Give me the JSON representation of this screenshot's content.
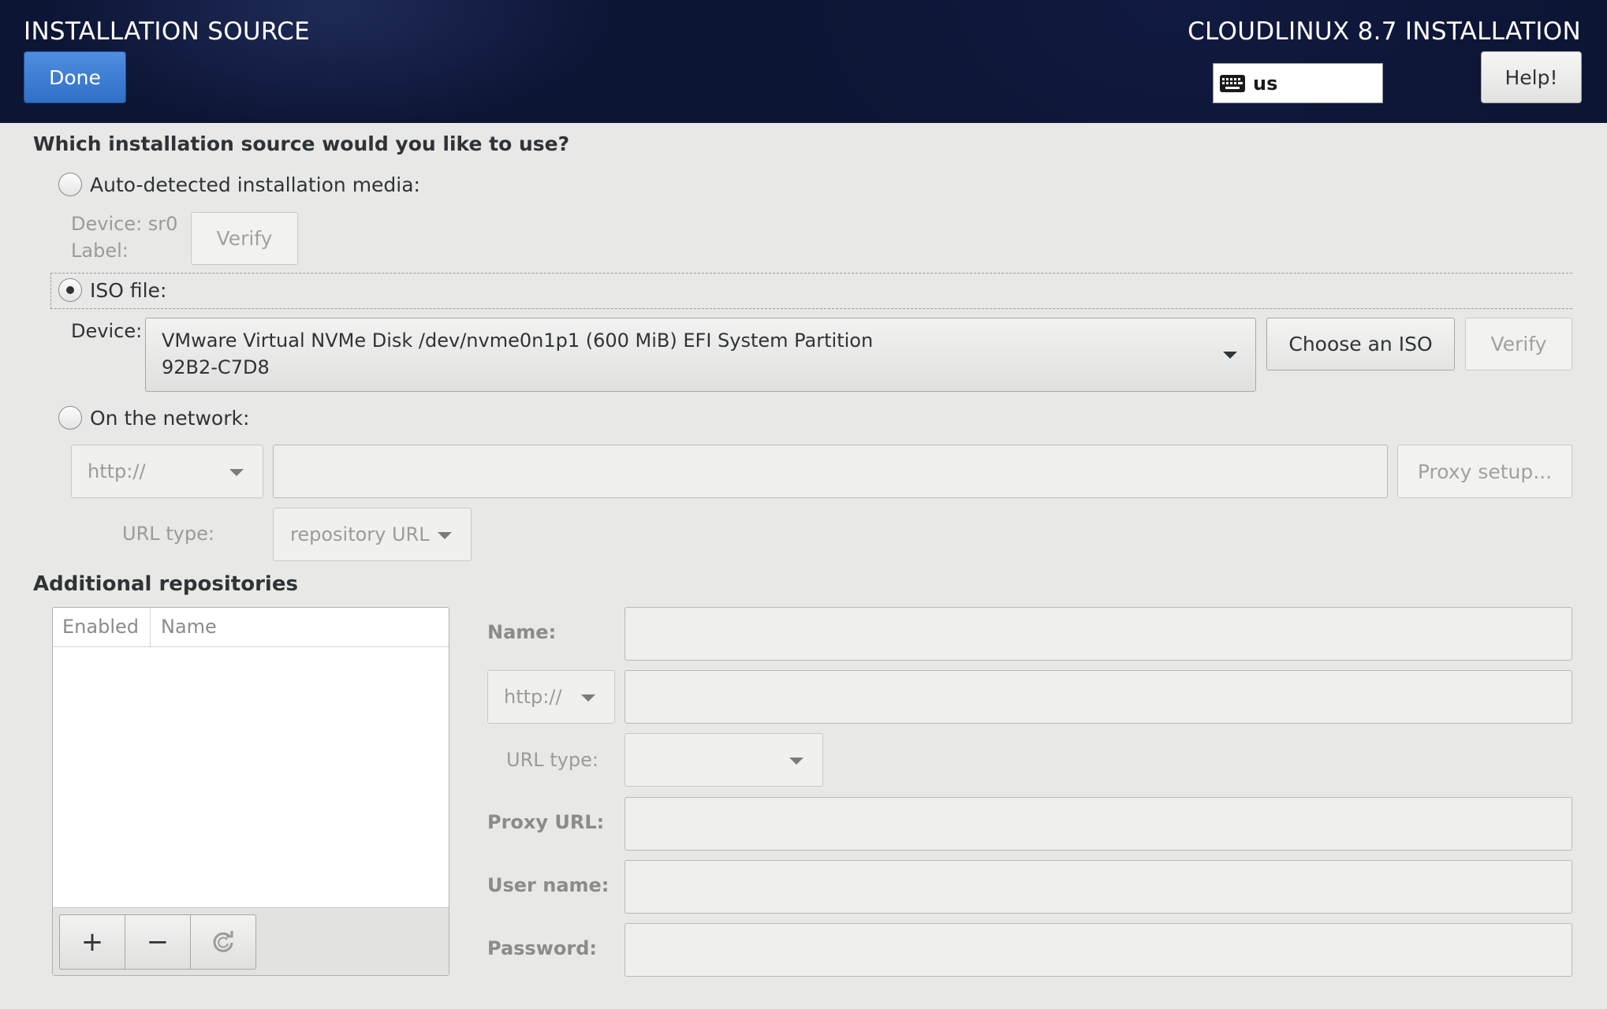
{
  "header": {
    "title": "INSTALLATION SOURCE",
    "product_title": "CLOUDLINUX 8.7 INSTALLATION",
    "done_label": "Done",
    "keyboard_layout": "us",
    "help_label": "Help!"
  },
  "source": {
    "question": "Which installation source would you like to use?",
    "auto_detected": {
      "label": "Auto-detected installation media:",
      "selected": false,
      "device_text": "Device: sr0",
      "label_text": "Label:",
      "verify_label": "Verify"
    },
    "iso": {
      "label": "ISO file:",
      "selected": true,
      "device_label": "Device:",
      "device_line1": "VMware Virtual NVMe Disk /dev/nvme0n1p1 (600 MiB) EFI System Partition",
      "device_line2": "92B2-C7D8",
      "choose_label": "Choose an ISO",
      "verify_label": "Verify"
    },
    "network": {
      "label": "On the network:",
      "selected": false,
      "protocol": "http://",
      "url_value": "",
      "proxy_label": "Proxy setup...",
      "url_type_label": "URL type:",
      "url_type_value": "repository URL"
    }
  },
  "repos": {
    "heading": "Additional repositories",
    "columns": [
      "Enabled",
      "Name"
    ],
    "rows": [],
    "toolbar": {
      "add": "+",
      "remove": "−",
      "reset_icon": "refresh-icon"
    },
    "form": {
      "name_label": "Name:",
      "protocol": "http://",
      "url_type_label": "URL type:",
      "url_type_value": "",
      "proxy_url_label": "Proxy URL:",
      "user_name_label": "User name:",
      "password_label": "Password:"
    }
  },
  "colors": {
    "header_bg": "#0d1535",
    "done_button": "#3b7dd8",
    "page_bg": "#e8e8e7"
  }
}
